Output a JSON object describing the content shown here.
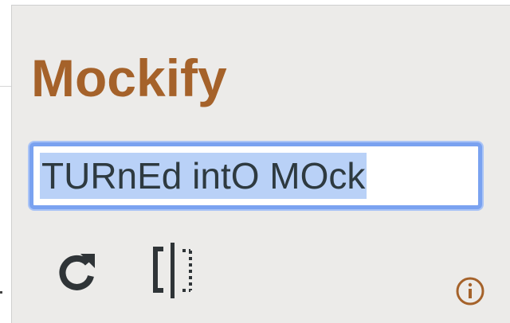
{
  "app": {
    "title": "Mockify"
  },
  "input": {
    "value": "TURnEd intO MOck"
  },
  "toolbar": {
    "refresh_icon": "refresh-icon",
    "split_icon": "split-compare-icon",
    "info_icon": "info-icon"
  },
  "colors": {
    "brand": "#a5622a",
    "focus_ring": "#7aa2f0",
    "selection": "#b9d1f7",
    "panel": "#ecebe9"
  }
}
